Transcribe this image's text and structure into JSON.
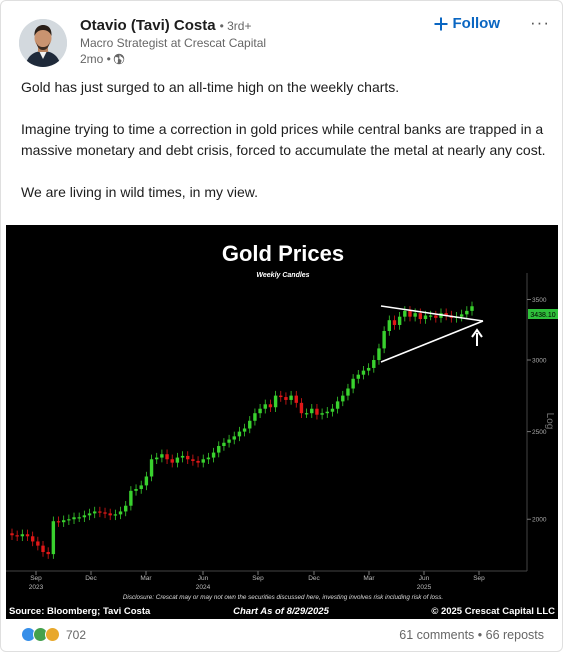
{
  "post": {
    "author_name": "Otavio (Tavi) Costa",
    "degree": "• 3rd+",
    "headline": "Macro Strategist at Crescat Capital",
    "time": "2mo •",
    "follow_label": "Follow",
    "more_label": "···",
    "paragraphs": [
      "Gold has just surged to an all-time high on the weekly charts.",
      "Imagine trying to time a correction in gold prices while central banks are trapped in a massive monetary and debt crisis, forced to accumulate the metal at nearly any cost.",
      "We are living in wild times, in my view."
    ]
  },
  "chart_data": {
    "type": "candlestick",
    "title": "Gold Prices",
    "subtitle": "Weekly Candles",
    "y_axis_label": "Log",
    "y_scale": "log",
    "ylim": [
      1780,
      3650
    ],
    "y_ticks": [
      "3500",
      "3000",
      "2500",
      "2000"
    ],
    "last_price_label": "3438.10",
    "x_ticks": [
      {
        "label": "Sep",
        "year": "2023"
      },
      {
        "label": "Dec",
        "year": ""
      },
      {
        "label": "Mar",
        "year": ""
      },
      {
        "label": "Jun",
        "year": "2024"
      },
      {
        "label": "Sep",
        "year": ""
      },
      {
        "label": "Dec",
        "year": ""
      },
      {
        "label": "Mar",
        "year": ""
      },
      {
        "label": "Jun",
        "year": "2025"
      },
      {
        "label": "Sep",
        "year": ""
      }
    ],
    "close_prices": [
      1920,
      1915,
      1925,
      1915,
      1890,
      1870,
      1840,
      1830,
      1990,
      1985,
      1995,
      2000,
      2010,
      2010,
      2020,
      2030,
      2040,
      2035,
      2030,
      2020,
      2025,
      2040,
      2070,
      2150,
      2160,
      2180,
      2230,
      2330,
      2340,
      2360,
      2330,
      2310,
      2340,
      2350,
      2330,
      2320,
      2310,
      2330,
      2340,
      2370,
      2410,
      2430,
      2450,
      2470,
      2500,
      2520,
      2570,
      2620,
      2650,
      2680,
      2660,
      2740,
      2730,
      2710,
      2740,
      2690,
      2620,
      2620,
      2650,
      2610,
      2620,
      2630,
      2650,
      2700,
      2740,
      2790,
      2860,
      2890,
      2920,
      2940,
      3000,
      3090,
      3230,
      3320,
      3280,
      3350,
      3400,
      3350,
      3380,
      3330,
      3360,
      3360,
      3340,
      3380,
      3360,
      3340,
      3350,
      3370,
      3400,
      3440
    ],
    "annotation": "triangle consolidation pattern with upward arrow",
    "source": "Source: Bloomberg; Tavi Costa",
    "as_of": "Chart As of 8/29/2025",
    "copyright": "© 2025 Crescat Capital LLC",
    "disclosure": "Disclosure: Crescat may or may not own the securities discussed here, investing involves risk including risk of loss."
  },
  "footer": {
    "reaction_count": "702",
    "comments": "61 comments",
    "reposts": "66 reposts",
    "separator": " • "
  },
  "colors": {
    "accent": "#0a66c2",
    "up_candle": "#39d12e",
    "down_candle": "#e01818",
    "price_tag": "#2fc13b",
    "chart_bg": "#000000"
  },
  "icons": [
    "avatar-photo",
    "globe-icon",
    "plus-icon",
    "more-icon",
    "like-reaction-icon",
    "celebrate-reaction-icon",
    "insightful-reaction-icon"
  ]
}
